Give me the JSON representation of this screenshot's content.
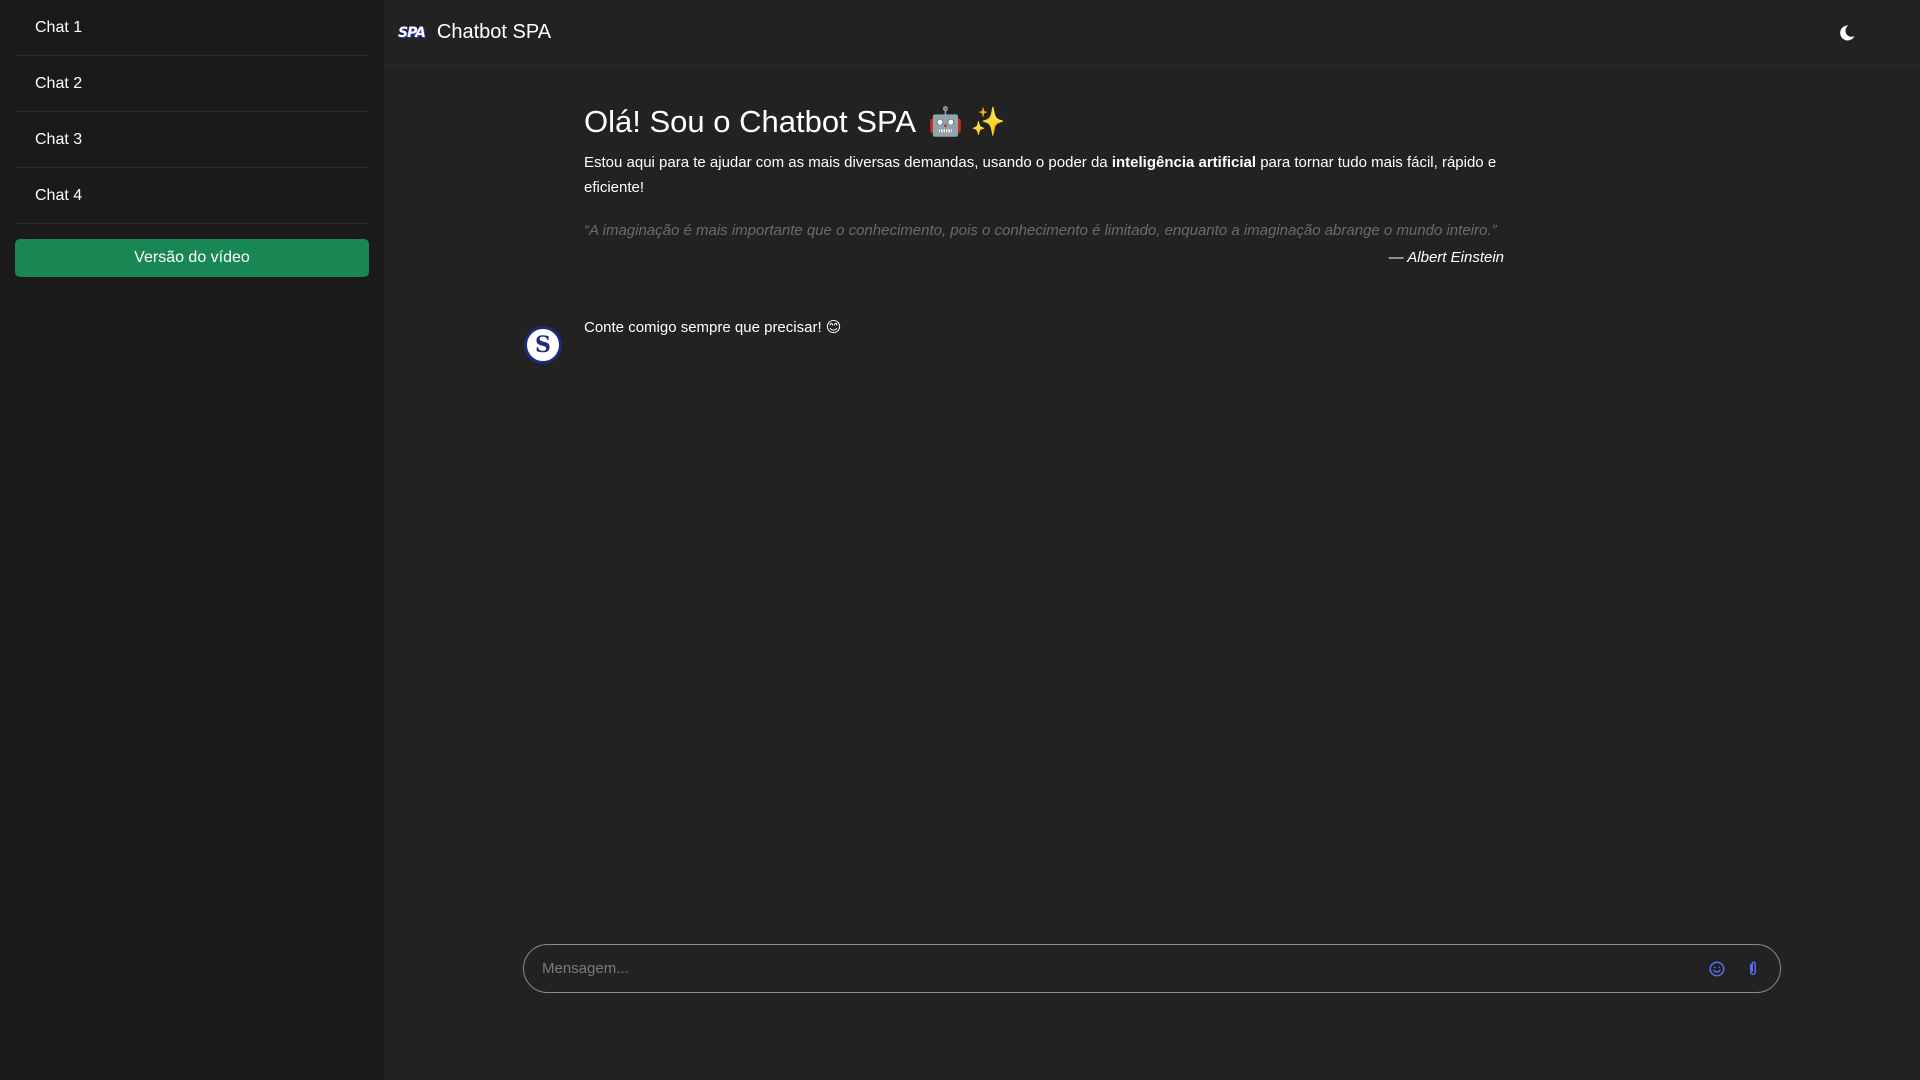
{
  "sidebar": {
    "items": [
      {
        "label": "Chat 1"
      },
      {
        "label": "Chat 2"
      },
      {
        "label": "Chat 3"
      },
      {
        "label": "Chat 4"
      }
    ],
    "video_button_label": "Versão do vídeo"
  },
  "header": {
    "logo_text": "SPA",
    "title": "Chatbot SPA",
    "theme_icon": "moon-icon"
  },
  "welcome": {
    "title": "Olá! Sou o Chatbot SPA",
    "title_emojis": "🤖 ✨",
    "intro_before": "Estou aqui para te ajudar com as mais diversas demandas, usando o poder da ",
    "intro_bold": "inteligência artificial",
    "intro_after": " para tornar tudo mais fácil, rápido e eficiente!",
    "quote": "“A imaginação é mais importante que o conhecimento, pois o conhecimento é limitado, enquanto a imaginação abrange o mundo inteiro.”",
    "quote_author": "— Albert Einstein"
  },
  "messages": [
    {
      "avatar_letter": "S",
      "text": "Conte comigo sempre que precisar! 😊"
    }
  ],
  "input": {
    "placeholder": "Mensagem...",
    "value": "",
    "emoji_icon": "smiley-icon",
    "attach_icon": "paperclip-icon"
  },
  "colors": {
    "accent_green": "#198754",
    "icon_blue": "#5b6cf0",
    "background": "#222222",
    "sidebar_bg": "#1a1a1a"
  }
}
